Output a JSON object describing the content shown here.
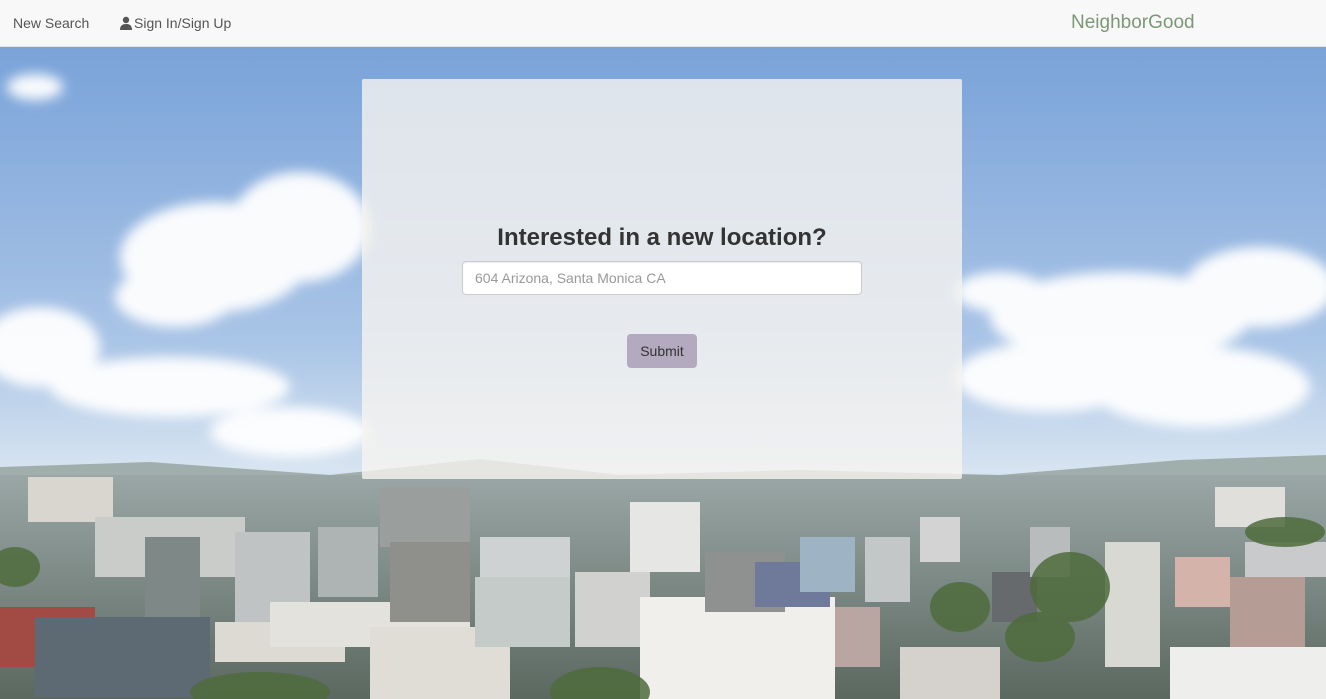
{
  "navbar": {
    "new_search_label": "New Search",
    "sign_in_label": "Sign In/Sign Up",
    "brand": "NeighborGood",
    "icons": {
      "sign_in": "user-icon"
    }
  },
  "search_panel": {
    "heading": "Interested in a new location?",
    "input": {
      "value": "",
      "placeholder": "604 Arizona, Santa Monica CA"
    },
    "submit_label": "Submit"
  },
  "colors": {
    "navbar_bg": "#f8f8f8",
    "brand": "#7d9876",
    "submit_button": "#b3aabf",
    "panel_bg": "rgba(246,244,240,0.8)"
  }
}
